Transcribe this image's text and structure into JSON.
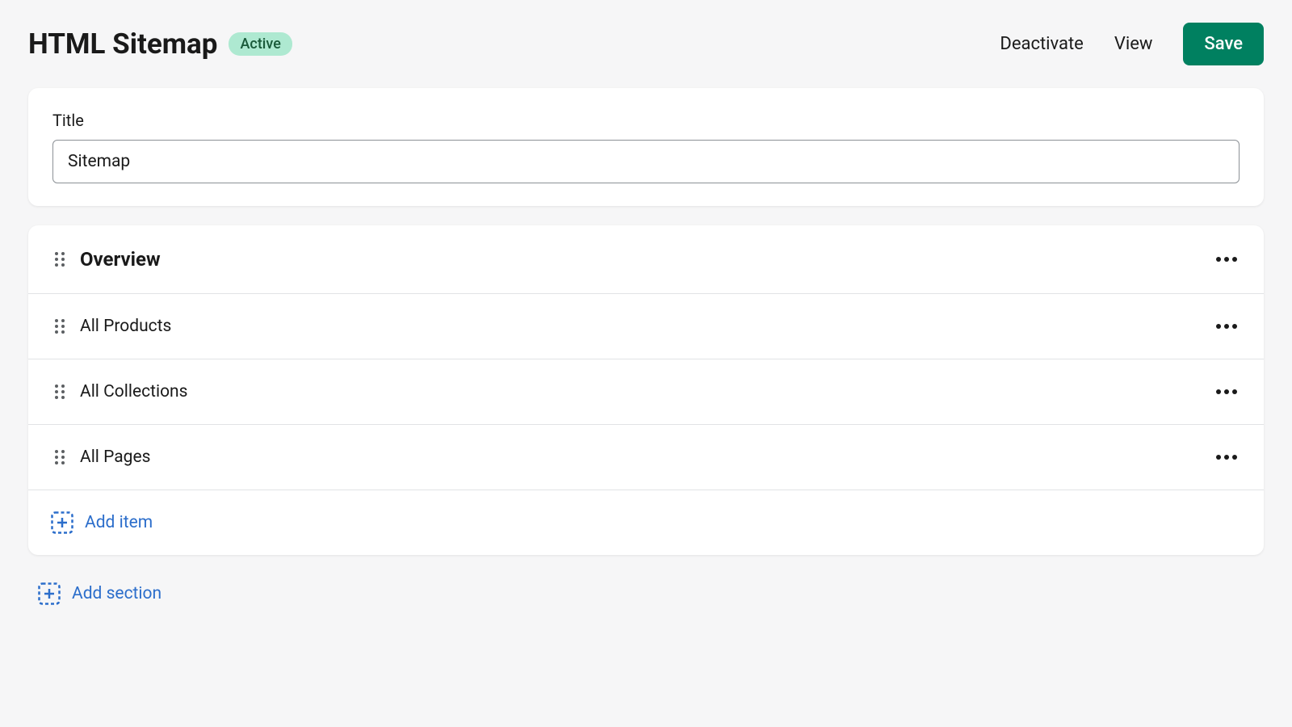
{
  "header": {
    "title": "HTML Sitemap",
    "badge": "Active",
    "deactivate_label": "Deactivate",
    "view_label": "View",
    "save_label": "Save"
  },
  "title_field": {
    "label": "Title",
    "value": "Sitemap"
  },
  "section": {
    "title": "Overview",
    "items": [
      {
        "label": "All Products"
      },
      {
        "label": "All Collections"
      },
      {
        "label": "All Pages"
      }
    ],
    "add_item_label": "Add item"
  },
  "add_section_label": "Add section"
}
